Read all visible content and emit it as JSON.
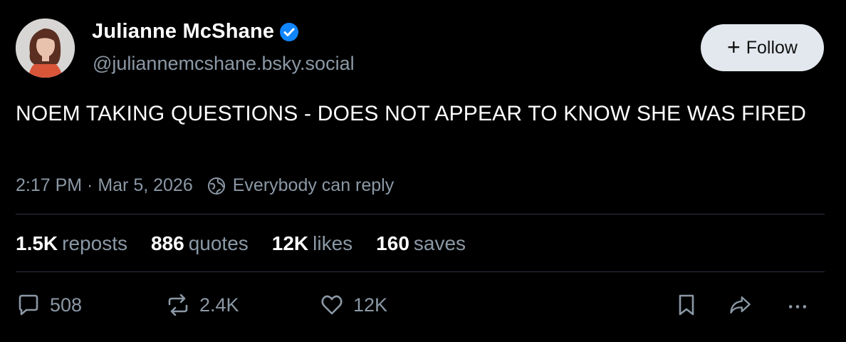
{
  "author": {
    "display_name": "Julianne McShane",
    "handle": "@juliannemcshane.bsky.social",
    "verified": true
  },
  "follow_button": {
    "label": "Follow"
  },
  "post": {
    "text": "NOEM TAKING QUESTIONS - DOES NOT APPEAR TO KNOW SHE WAS FIRED",
    "timestamp": "2:17 PM · Mar 5, 2026",
    "reply_setting": "Everybody can reply"
  },
  "stats": [
    {
      "count": "1.5K",
      "label": "reposts"
    },
    {
      "count": "886",
      "label": "quotes"
    },
    {
      "count": "12K",
      "label": "likes"
    },
    {
      "count": "160",
      "label": "saves"
    }
  ],
  "actions": {
    "replies": "508",
    "reposts": "2.4K",
    "likes": "12K"
  },
  "colors": {
    "background": "#000000",
    "muted_text": "#8b98a5",
    "verified_blue": "#1185fe",
    "follow_bg": "#e3e8ee"
  }
}
